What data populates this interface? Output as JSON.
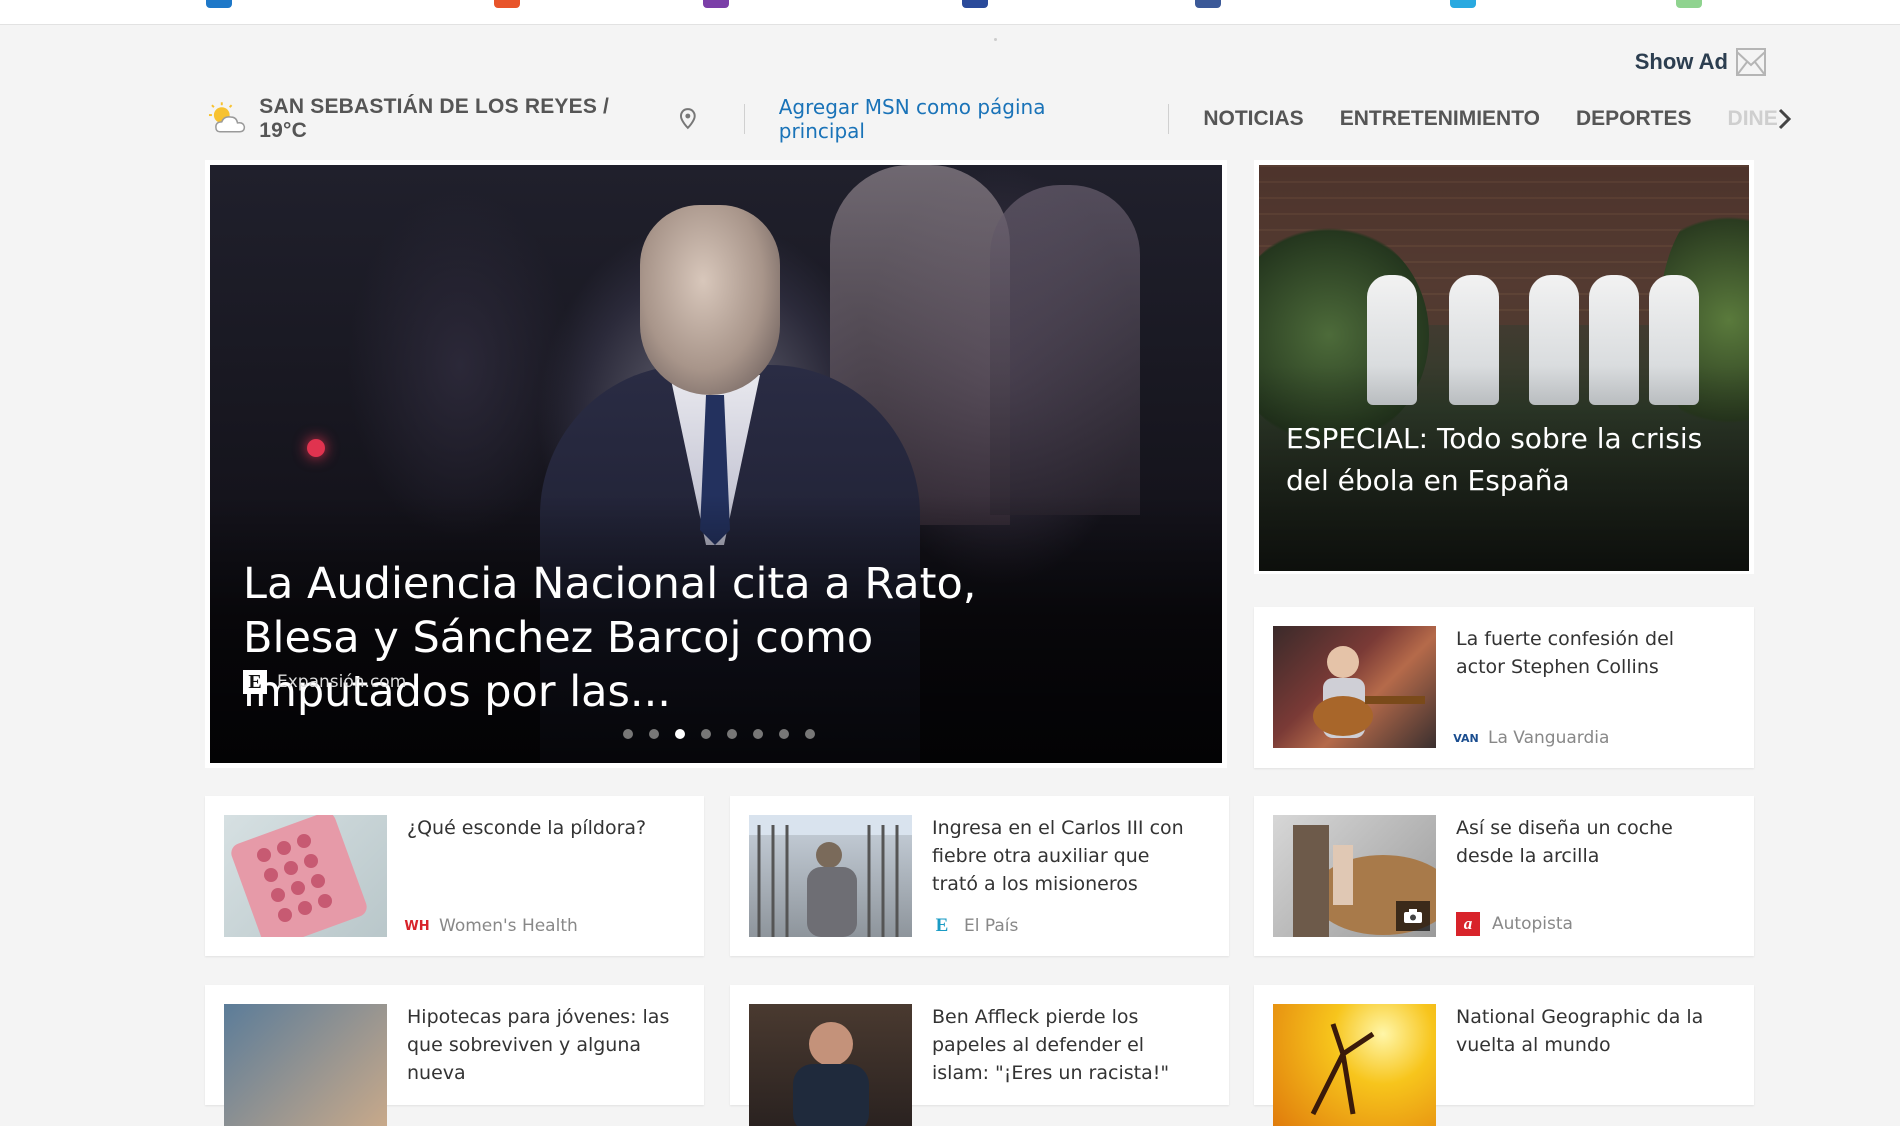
{
  "top_icon_colors": [
    "#1e78c8",
    "#e8542a",
    "#7b3fa8",
    "#2a4a9a",
    "#3b5998",
    "#29a9e0",
    "#8fd38f"
  ],
  "header": {
    "show_ad_label": "Show Ad"
  },
  "nav": {
    "location": "SAN SEBASTIÁN DE LOS REYES / 19°C",
    "add_msn_link": "Agregar MSN como página principal",
    "categories": [
      "NOTICIAS",
      "ENTRETENIMIENTO",
      "DEPORTES",
      "DINE"
    ]
  },
  "hero": {
    "title": "La Audiencia Nacional cita a Rato, Blesa y Sánchez Barcoj como imputados por las...",
    "source": "Expansión.com",
    "source_logo": "E",
    "slide_count": 8,
    "active_slide": 3
  },
  "feature": {
    "title": "ESPECIAL: Todo sobre la crisis del ébola en España"
  },
  "cards": [
    {
      "title": "La fuerte confesión del actor Stephen Collins",
      "source": "La Vanguardia",
      "logo": "VAN",
      "logo_color": "#1a4d8f"
    },
    {
      "title": "¿Qué esconde la píldora?",
      "source": "Women's Health",
      "logo": "WH",
      "logo_color": "#d8232a"
    },
    {
      "title": "Ingresa en el Carlos III con fiebre otra auxiliar que trató a los misioneros",
      "source": "El País",
      "logo": "E",
      "logo_color": "#1a9bc4"
    },
    {
      "title": "Así se diseña un coche desde la arcilla",
      "source": "Autopista",
      "logo": "a",
      "logo_color": "#d8232a"
    },
    {
      "title": "Hipotecas para jóvenes: las que sobreviven y alguna nueva",
      "source": "",
      "logo": "",
      "logo_color": "#999"
    },
    {
      "title": "Ben Affleck pierde los papeles al defender el islam: \"¡Eres un racista!\"",
      "source": "",
      "logo": "",
      "logo_color": "#999"
    },
    {
      "title": "National Geographic da la vuelta al mundo",
      "source": "",
      "logo": "",
      "logo_color": "#999"
    }
  ]
}
